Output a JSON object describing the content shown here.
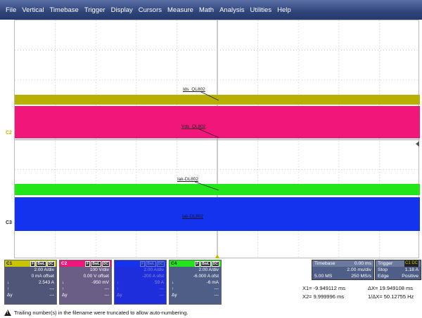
{
  "menu": [
    "File",
    "Vertical",
    "Timebase",
    "Trigger",
    "Display",
    "Cursors",
    "Measure",
    "Math",
    "Analysis",
    "Utilities",
    "Help"
  ],
  "colors": {
    "c1": "#b8b000",
    "c2": "#f0167a",
    "c3": "#1433ee",
    "c4": "#22e61a",
    "menubar": "#2f4479",
    "panel": "#4f5e86"
  },
  "traces": {
    "c1": {
      "label": "Ids_QL802"
    },
    "c2": {
      "label": "Vds_QL802"
    },
    "c4": {
      "label": "Iak-DL802"
    },
    "c3": {
      "label": "Iak-DL802"
    }
  },
  "markers": {
    "c2": "C2",
    "c3": "C3"
  },
  "channels": [
    {
      "name": "C1",
      "tags": [
        "F",
        "BwL",
        "DC"
      ],
      "vdiv": "2.00 A/div",
      "offset": "0 mA offset",
      "val1": "2.543 A",
      "val2": "---",
      "val3": "---",
      "r1": "",
      "r2": "↓",
      "r3": "↑",
      "r4": "Δy"
    },
    {
      "name": "C2",
      "tags": [
        "F",
        "BwL",
        "DC"
      ],
      "vdiv": "100 V/div",
      "offset": "0.00 V offset",
      "val1": "-950 mV",
      "val2": "---",
      "val3": "---",
      "r1": "",
      "r2": "↓",
      "r3": "↑",
      "r4": "Δy"
    },
    {
      "name": "C3",
      "tags": [
        "F",
        "BwL",
        "DC"
      ],
      "vdiv": "2.00 A/div",
      "offset": "-200 A ofst",
      "val1": "59 A",
      "val2": "---",
      "val3": "---",
      "r1": "",
      "r2": "↓",
      "r3": "↑",
      "r4": "Δy"
    },
    {
      "name": "C4",
      "tags": [
        "F",
        "BwL",
        "DC"
      ],
      "vdiv": "2.00 A/div",
      "offset": "-6.000 A ofst",
      "val1": "-6 mA",
      "val2": "---",
      "val3": "---",
      "r1": "",
      "r2": "↓",
      "r3": "↑",
      "r4": "Δy"
    }
  ],
  "timebase": {
    "label": "Timebase",
    "delay": "0.00 ms",
    "tdiv": "2.00 ms/div",
    "samples": "5.00 MS",
    "rate": "250 MS/s"
  },
  "trigger": {
    "label": "Trigger",
    "badge": "C1 DC",
    "mode": "Stop",
    "level": "1.18 A",
    "type": "Edge",
    "slope": "Positive"
  },
  "cursors": {
    "x1": "X1=  -9.949112 ms",
    "dx": "ΔX=  19.949108 ms",
    "x2": "X2=  9.999996 ms",
    "inv_dx": "1/ΔX=    50.12755 Hz"
  },
  "status": {
    "message": "Trailing number(s) in the filename were truncated to allow auto-numbering."
  }
}
